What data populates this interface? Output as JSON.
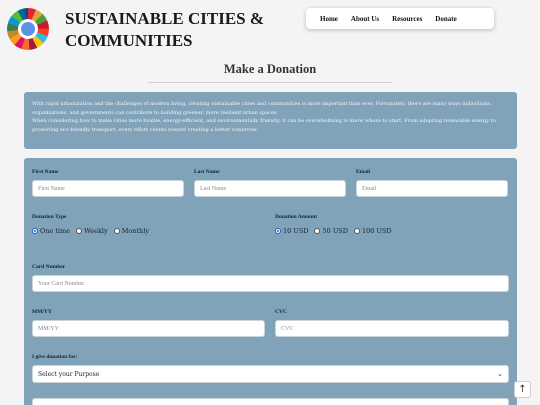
{
  "site": {
    "title": "SUSTAINABLE CITIES & COMMUNITIES"
  },
  "nav": {
    "items": [
      "Home",
      "About Us",
      "Resources",
      "Donate"
    ]
  },
  "page": {
    "heading": "Make a Donation"
  },
  "intro": {
    "p1": "With rapid urbanization and the challenges of modern living, creating sustainable cities and communities is more important than ever. Fortunately, there are many ways individuals, organizations, and governments can contribute to building greener, more resilient urban spaces.",
    "p2": "When considering how to make cities more livable, energy-efficient, and environmentally friendly, it can be overwhelming to know where to start. From adopting renewable energy to promoting eco-friendly transport, every effort counts toward creating a better tomorrow."
  },
  "form": {
    "first_name": {
      "label": "First Name",
      "placeholder": "First Name"
    },
    "last_name": {
      "label": "Last Name",
      "placeholder": "Last Name"
    },
    "email": {
      "label": "Email",
      "placeholder": "Email"
    },
    "donation_type": {
      "label": "Donation Type",
      "options": [
        "One time",
        "Weekly",
        "Monthly"
      ],
      "selected": "One time"
    },
    "donation_amount": {
      "label": "Donation Amount",
      "options": [
        "10 USD",
        "50 USD",
        "100 USD"
      ],
      "selected": "10 USD"
    },
    "card_number": {
      "label": "Card Number",
      "placeholder": "Your Card Number"
    },
    "mm_yy": {
      "label": "MM/YY",
      "placeholder": "MM/YY"
    },
    "cvc": {
      "label": "CVC",
      "placeholder": "CVC"
    },
    "purpose": {
      "label": "I give donation for:",
      "selected": "Select your Purpose"
    }
  },
  "icons": {
    "scroll_top": "arrow-up-icon",
    "logo": "sdg-wheel-logo",
    "select_chevron": "chevron-down-icon"
  }
}
